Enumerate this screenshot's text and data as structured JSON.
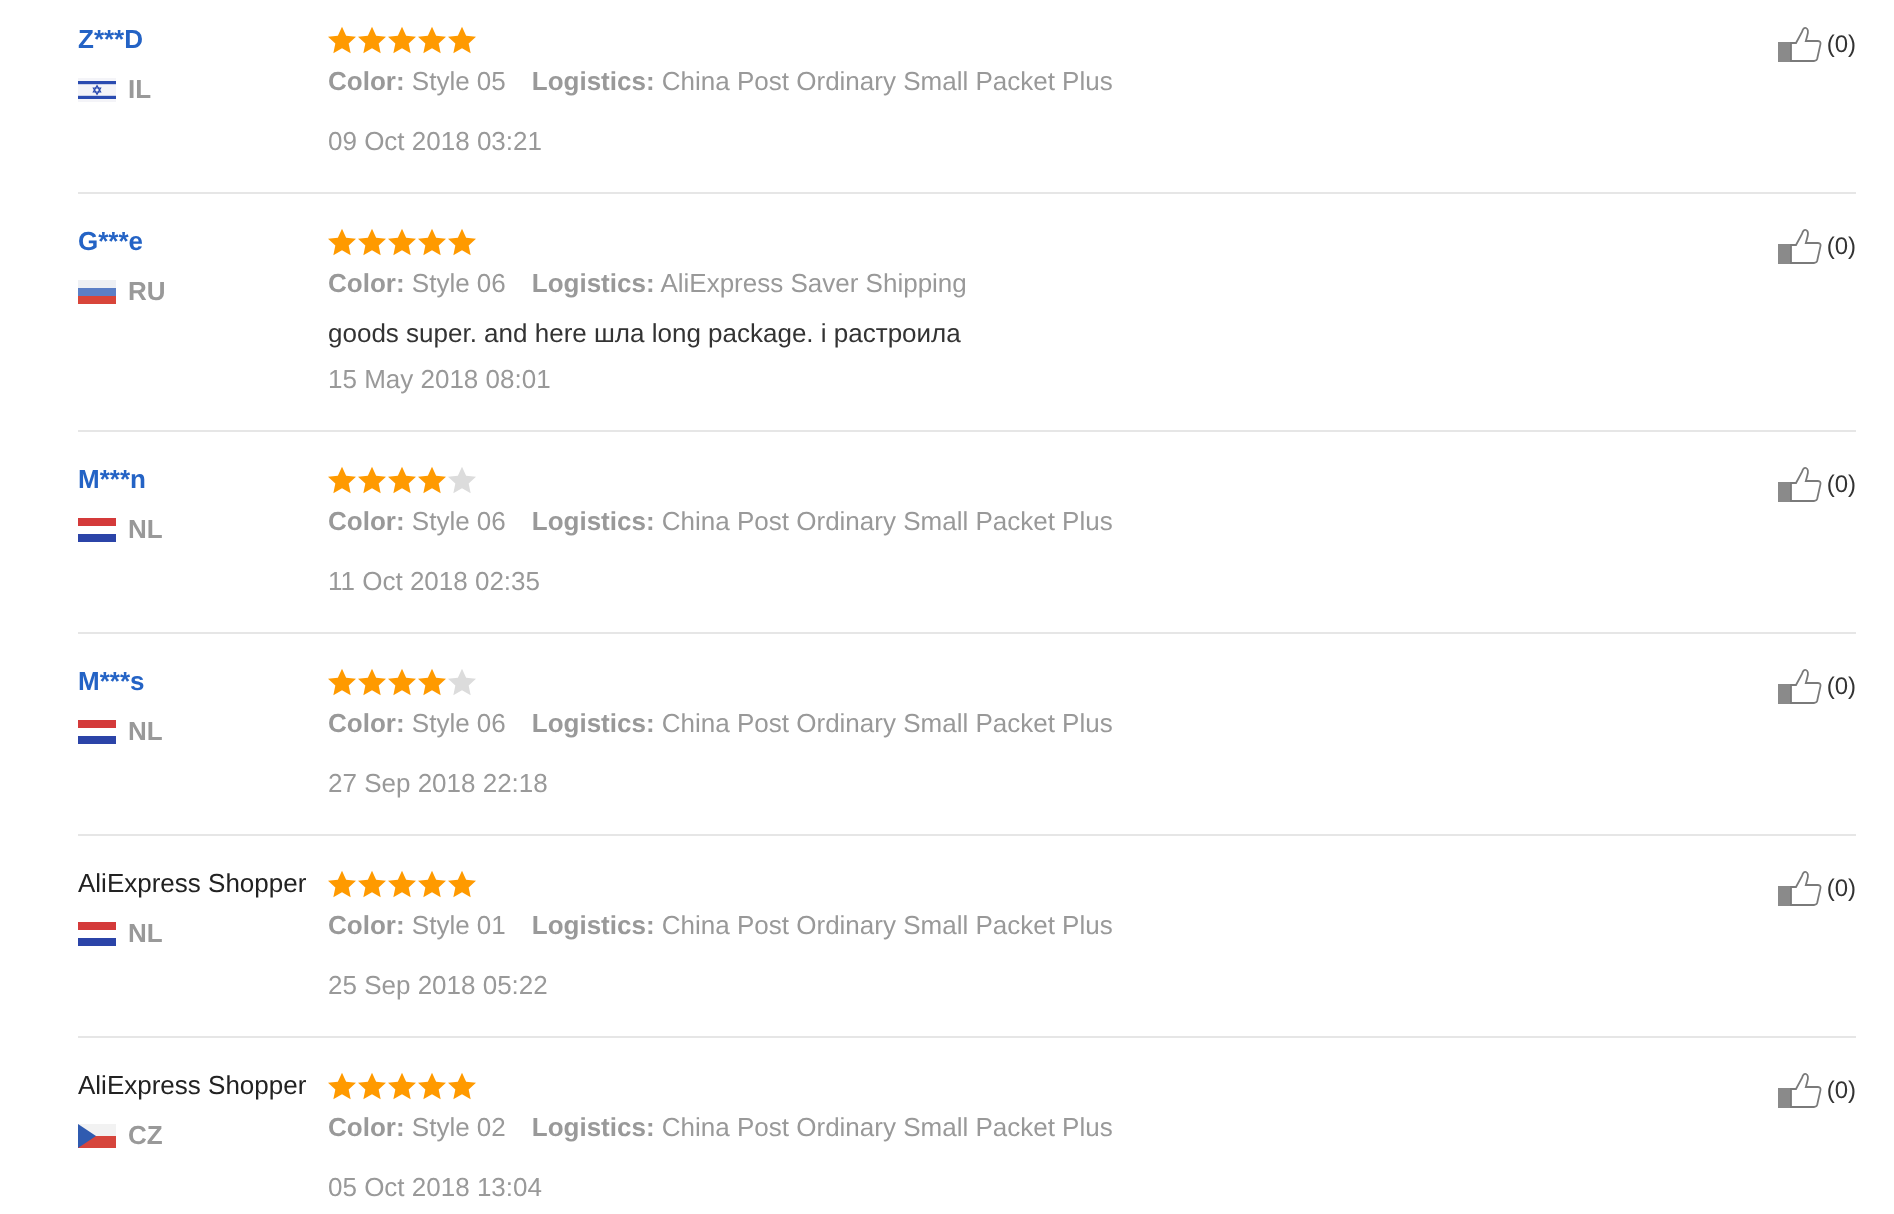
{
  "reviews": [
    {
      "reviewer": {
        "name": "Z***D",
        "kind": "link"
      },
      "country": {
        "kind": "il",
        "code": "IL"
      },
      "stars": 5,
      "attributes": [
        {
          "label": "Color:",
          "value": "Style 05"
        },
        {
          "label": "Logistics:",
          "value": "China Post Ordinary Small Packet Plus"
        }
      ],
      "date": "09 Oct 2018 03:21",
      "helpful": "(0)"
    },
    {
      "reviewer": {
        "name": "G***e",
        "kind": "link"
      },
      "country": {
        "kind": "ru",
        "code": "RU"
      },
      "stars": 5,
      "attributes": [
        {
          "label": "Color:",
          "value": "Style 06"
        },
        {
          "label": "Logistics:",
          "value": "AliExpress Saver Shipping"
        }
      ],
      "text": "goods super. and here шла long package. і растроила",
      "date": "15 May 2018 08:01",
      "helpful": "(0)"
    },
    {
      "reviewer": {
        "name": "M***n",
        "kind": "link"
      },
      "country": {
        "kind": "nl",
        "code": "NL"
      },
      "stars": 4,
      "attributes": [
        {
          "label": "Color:",
          "value": "Style 06"
        },
        {
          "label": "Logistics:",
          "value": "China Post Ordinary Small Packet Plus"
        }
      ],
      "date": "11 Oct 2018 02:35",
      "helpful": "(0)"
    },
    {
      "reviewer": {
        "name": "M***s",
        "kind": "link"
      },
      "country": {
        "kind": "nl",
        "code": "NL"
      },
      "stars": 4,
      "attributes": [
        {
          "label": "Color:",
          "value": "Style 06"
        },
        {
          "label": "Logistics:",
          "value": "China Post Ordinary Small Packet Plus"
        }
      ],
      "date": "27 Sep 2018 22:18",
      "helpful": "(0)"
    },
    {
      "reviewer": {
        "name": "AliExpress Shopper",
        "kind": "plain"
      },
      "country": {
        "kind": "nl",
        "code": "NL"
      },
      "stars": 5,
      "attributes": [
        {
          "label": "Color:",
          "value": "Style 01"
        },
        {
          "label": "Logistics:",
          "value": "China Post Ordinary Small Packet Plus"
        }
      ],
      "date": "25 Sep 2018 05:22",
      "helpful": "(0)"
    },
    {
      "reviewer": {
        "name": "AliExpress Shopper",
        "kind": "plain"
      },
      "country": {
        "kind": "cz",
        "code": "CZ"
      },
      "stars": 5,
      "attributes": [
        {
          "label": "Color:",
          "value": "Style 02"
        },
        {
          "label": "Logistics:",
          "value": "China Post Ordinary Small Packet Plus"
        }
      ],
      "date": "05 Oct 2018 13:04",
      "helpful": "(0)"
    }
  ]
}
